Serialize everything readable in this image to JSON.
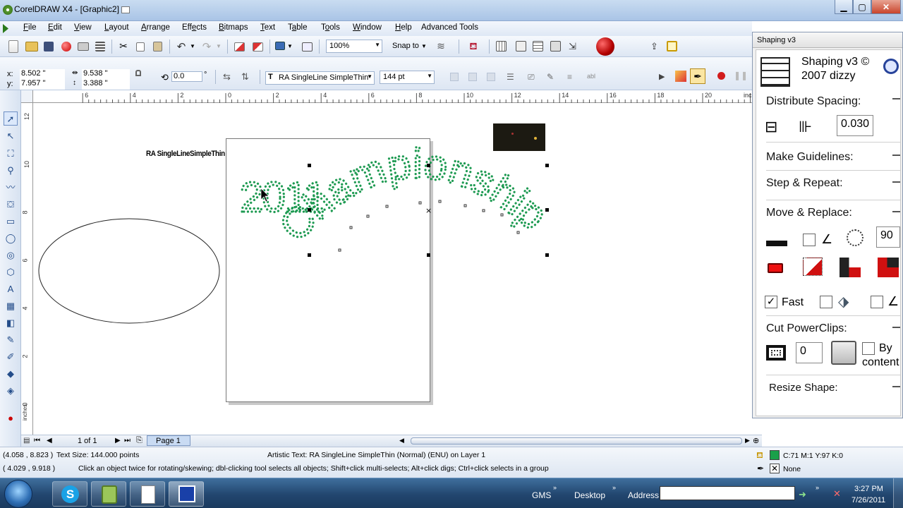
{
  "window": {
    "title": "CorelDRAW X4 - [Graphic2]"
  },
  "menu": [
    {
      "pre": "",
      "ul": "F",
      "post": "ile"
    },
    {
      "pre": "",
      "ul": "E",
      "post": "dit"
    },
    {
      "pre": "",
      "ul": "V",
      "post": "iew"
    },
    {
      "pre": "",
      "ul": "L",
      "post": "ayout"
    },
    {
      "pre": "",
      "ul": "A",
      "post": "rrange"
    },
    {
      "pre": "Eff",
      "ul": "e",
      "post": "cts"
    },
    {
      "pre": "",
      "ul": "B",
      "post": "itmaps"
    },
    {
      "pre": "",
      "ul": "T",
      "post": "ext"
    },
    {
      "pre": "T",
      "ul": "a",
      "post": "ble"
    },
    {
      "pre": "T",
      "ul": "o",
      "post": "ols"
    },
    {
      "pre": "",
      "ul": "W",
      "post": "indow"
    },
    {
      "pre": "",
      "ul": "H",
      "post": "elp"
    },
    {
      "pre": "",
      "ul": "",
      "post": "Advanced Tools"
    }
  ],
  "toolbar": {
    "zoom": "100%",
    "snap_to": "Snap to"
  },
  "property_bar": {
    "x_label": "x:",
    "x": "8.502 \"",
    "y_label": "y:",
    "y": "7.957 \"",
    "w": "9.538 \"",
    "h": "3.388 \"",
    "rotation": "0.0",
    "degree": "°",
    "font_name": "RA SingleLine SimpleThin",
    "font_size": "144 pt"
  },
  "ruler": {
    "h_labels": [
      "6",
      "4",
      "2",
      "0",
      "2",
      "4",
      "6",
      "8",
      "10",
      "12",
      "14",
      "16",
      "18",
      "20"
    ],
    "unit": "inches",
    "v_labels": [
      "12",
      "10",
      "8",
      "6",
      "4",
      "2",
      "0"
    ]
  },
  "canvas": {
    "font_label": "RA SingleLineSimpleThin",
    "text_2011": "2011",
    "text_championship": "Championship"
  },
  "page_nav": {
    "count": "1 of 1",
    "tab": "Page 1"
  },
  "status": {
    "coords1": "(4.058 , 8.823 )",
    "text_size": "Text Size: 144.000 points",
    "object_info": "Artistic Text: RA SingleLine SimpleThin (Normal) (ENU) on Layer 1",
    "coords2": "( 4.029 , 9.918 )",
    "hint": "Click an object twice for rotating/skewing; dbl-clicking tool selects all objects; Shift+click multi-selects; Alt+click digs; Ctrl+click selects in a group",
    "fill": "C:71 M:1 Y:97 K:0",
    "outline": "None",
    "fill_color": "#1aa04a"
  },
  "docker": {
    "title": "Shaping v3",
    "header_line1": "Shaping v3 ©",
    "header_line2": "2007 dizzy",
    "distribute": "Distribute Spacing:",
    "distribute_value": "0.030",
    "guidelines": "Make Guidelines:",
    "step_repeat": "Step & Repeat:",
    "move_replace": "Move & Replace:",
    "angle": "90",
    "fast": "Fast",
    "cut_powerclips": "Cut PowerClips:",
    "cut_value": "0",
    "by_content_1": "By",
    "by_content_2": "content",
    "resize": "Resize Shape:"
  },
  "taskbar": {
    "gms": "GMS",
    "desktop": "Desktop",
    "address": "Address",
    "time": "3:27 PM",
    "date": "7/26/2011"
  },
  "colors": {
    "dot_green": "#1e9a52",
    "taskbar": "#22466f"
  }
}
